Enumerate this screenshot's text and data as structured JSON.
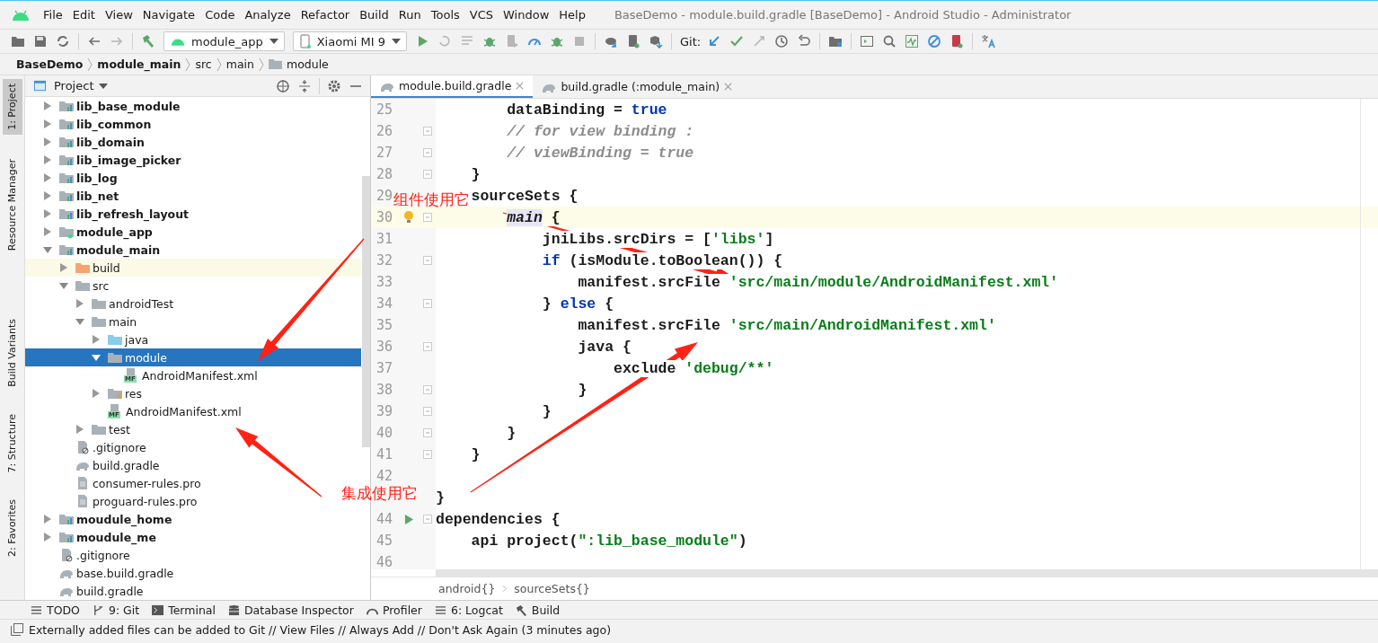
{
  "menu": [
    "File",
    "Edit",
    "View",
    "Navigate",
    "Code",
    "Analyze",
    "Refactor",
    "Build",
    "Run",
    "Tools",
    "VCS",
    "Window",
    "Help"
  ],
  "window": {
    "title": "BaseDemo - module.build.gradle [BaseDemo] - Android Studio - Administrator"
  },
  "toolbar": [
    {
      "kind": "open",
      "disabled": false
    },
    {
      "kind": "save",
      "disabled": false
    },
    {
      "kind": "sync",
      "disabled": false
    },
    {
      "kind": "separator"
    },
    {
      "kind": "back",
      "disabled": false
    },
    {
      "kind": "forward",
      "disabled": true
    },
    {
      "kind": "separator"
    },
    {
      "kind": "make",
      "disabled": false
    },
    {
      "kind": "config",
      "label": "module_app"
    },
    {
      "kind": "device",
      "label": "Xiaomi MI 9"
    },
    {
      "kind": "run",
      "disabled": false
    },
    {
      "kind": "apply_changes",
      "disabled": true
    },
    {
      "kind": "apply_code",
      "disabled": true
    },
    {
      "kind": "debug",
      "disabled": false
    },
    {
      "kind": "attach",
      "disabled": true
    },
    {
      "kind": "profile",
      "disabled": false
    },
    {
      "kind": "attach_debugger",
      "disabled": false
    },
    {
      "kind": "stop",
      "disabled": true
    },
    {
      "kind": "separator"
    },
    {
      "kind": "gradle_sync",
      "disabled": false
    },
    {
      "kind": "avd",
      "disabled": false
    },
    {
      "kind": "sdk",
      "disabled": false
    },
    {
      "kind": "separator"
    },
    {
      "kind": "label",
      "label": "Git:"
    },
    {
      "kind": "update",
      "disabled": false
    },
    {
      "kind": "commit",
      "disabled": false
    },
    {
      "kind": "push",
      "disabled": true
    },
    {
      "kind": "history",
      "disabled": false
    },
    {
      "kind": "rollback",
      "disabled": false
    },
    {
      "kind": "separator"
    },
    {
      "kind": "project_structure",
      "disabled": false
    },
    {
      "kind": "separator"
    },
    {
      "kind": "terminal",
      "disabled": false
    },
    {
      "kind": "search",
      "disabled": false
    },
    {
      "kind": "profiler",
      "disabled": false
    },
    {
      "kind": "no_entry",
      "disabled": false
    },
    {
      "kind": "device_explorer",
      "disabled": false
    },
    {
      "kind": "separator"
    },
    {
      "kind": "translate",
      "disabled": false
    }
  ],
  "breadcrumb": [
    {
      "label": "BaseDemo",
      "bold": true,
      "folder": false
    },
    {
      "label": "module_main",
      "bold": true,
      "folder": false
    },
    {
      "label": "src",
      "bold": false,
      "folder": false
    },
    {
      "label": "main",
      "bold": false,
      "folder": false
    },
    {
      "label": "module",
      "bold": false,
      "folder": true
    }
  ],
  "tool_stripe": [
    {
      "label": "1: Project",
      "selected": true
    },
    {
      "label": "Resource Manager",
      "selected": false
    },
    {
      "label": "Build Variants",
      "selected": false
    },
    {
      "label": "7: Structure",
      "selected": false
    },
    {
      "label": "2: Favorites",
      "selected": false
    }
  ],
  "project_panel": {
    "title": "Project",
    "tree": [
      {
        "label": "lib_base_module",
        "kind": "module",
        "expanded": false,
        "selected": false,
        "ignored": false
      },
      {
        "label": "lib_common",
        "kind": "module",
        "expanded": false,
        "selected": false,
        "ignored": false
      },
      {
        "label": "lib_domain",
        "kind": "module",
        "expanded": false,
        "selected": false,
        "ignored": false
      },
      {
        "label": "lib_image_picker",
        "kind": "module",
        "expanded": false,
        "selected": false,
        "ignored": false
      },
      {
        "label": "lib_log",
        "kind": "module",
        "expanded": false,
        "selected": false,
        "ignored": false
      },
      {
        "label": "lib_net",
        "kind": "module",
        "expanded": false,
        "selected": false,
        "ignored": false
      },
      {
        "label": "lib_refresh_layout",
        "kind": "module",
        "expanded": false,
        "selected": false,
        "ignored": false
      },
      {
        "label": "module_app",
        "kind": "app_module",
        "expanded": false,
        "selected": false,
        "ignored": false
      },
      {
        "label": "module_main",
        "kind": "module",
        "expanded": true,
        "selected": false,
        "ignored": false,
        "children": [
          {
            "label": "build",
            "kind": "build_folder",
            "expanded": false,
            "selected": false,
            "ignored": true
          },
          {
            "label": "src",
            "kind": "folder",
            "expanded": true,
            "selected": false,
            "ignored": false,
            "children": [
              {
                "label": "androidTest",
                "kind": "folder",
                "expanded": false,
                "selected": false,
                "ignored": false
              },
              {
                "label": "main",
                "kind": "folder",
                "expanded": true,
                "selected": false,
                "ignored": false,
                "children": [
                  {
                    "label": "java",
                    "kind": "source_folder",
                    "expanded": false,
                    "selected": false,
                    "ignored": false
                  },
                  {
                    "label": "module",
                    "kind": "folder",
                    "expanded": true,
                    "selected": true,
                    "ignored": false,
                    "children": [
                      {
                        "label": "AndroidManifest.xml",
                        "kind": "manifest",
                        "badge": "MF",
                        "selected": false,
                        "ignored": false
                      }
                    ]
                  },
                  {
                    "label": "res",
                    "kind": "res_folder",
                    "expanded": false,
                    "selected": false,
                    "ignored": false
                  },
                  {
                    "label": "AndroidManifest.xml",
                    "kind": "manifest",
                    "badge": "MF",
                    "selected": false,
                    "ignored": false
                  }
                ]
              },
              {
                "label": "test",
                "kind": "folder",
                "expanded": false,
                "selected": false,
                "ignored": false
              }
            ]
          },
          {
            "label": ".gitignore",
            "kind": "gitignore",
            "selected": false,
            "ignored": false
          },
          {
            "label": "build.gradle",
            "kind": "gradle",
            "selected": false,
            "ignored": false
          },
          {
            "label": "consumer-rules.pro",
            "kind": "text",
            "selected": false,
            "ignored": false
          },
          {
            "label": "proguard-rules.pro",
            "kind": "text",
            "selected": false,
            "ignored": false
          }
        ]
      },
      {
        "label": "moudule_home",
        "kind": "module",
        "expanded": false,
        "selected": false,
        "ignored": false
      },
      {
        "label": "moudule_me",
        "kind": "module",
        "expanded": false,
        "selected": false,
        "ignored": false
      },
      {
        "label": ".gitignore",
        "kind": "gitignore",
        "selected": false,
        "ignored": false
      },
      {
        "label": "base.build.gradle",
        "kind": "gradle",
        "selected": false,
        "ignored": false
      },
      {
        "label": "build.gradle",
        "kind": "gradle",
        "selected": false,
        "ignored": false
      }
    ]
  },
  "tabs": [
    {
      "label": "module.build.gradle",
      "selected": true
    },
    {
      "label": "build.gradle (:module_main)",
      "selected": false
    }
  ],
  "code_lines": [
    {
      "number": "25",
      "run_marker": false,
      "intention": false,
      "fold": false,
      "current": false,
      "segments": [
        {
          "kind": "plain",
          "text": "        dataBinding = "
        },
        {
          "kind": "keyword",
          "text": "true"
        }
      ]
    },
    {
      "number": "26",
      "run_marker": false,
      "intention": false,
      "fold": true,
      "current": false,
      "segments": [
        {
          "kind": "comment",
          "text": "        // for view binding :"
        }
      ]
    },
    {
      "number": "27",
      "run_marker": false,
      "intention": false,
      "fold": true,
      "current": false,
      "segments": [
        {
          "kind": "comment",
          "text": "        // viewBinding = true"
        }
      ]
    },
    {
      "number": "28",
      "run_marker": false,
      "intention": false,
      "fold": true,
      "current": false,
      "segments": [
        {
          "kind": "plain",
          "text": "    }"
        }
      ]
    },
    {
      "number": "29",
      "run_marker": false,
      "intention": false,
      "fold": false,
      "current": false,
      "segments": [
        {
          "kind": "plain",
          "text": "    sourceSets {"
        }
      ]
    },
    {
      "number": "30",
      "run_marker": false,
      "intention": true,
      "fold": true,
      "current": true,
      "segments": [
        {
          "kind": "usage",
          "text": "        main"
        },
        {
          "kind": "plain",
          "text": " {"
        }
      ]
    },
    {
      "number": "31",
      "run_marker": false,
      "intention": false,
      "fold": false,
      "current": false,
      "segments": [
        {
          "kind": "plain",
          "text": "            jniLibs.srcDirs = ["
        },
        {
          "kind": "string",
          "text": "'libs'"
        },
        {
          "kind": "plain",
          "text": "]"
        }
      ]
    },
    {
      "number": "32",
      "run_marker": false,
      "intention": false,
      "fold": true,
      "current": false,
      "segments": [
        {
          "kind": "keyword",
          "text": "            if"
        },
        {
          "kind": "plain",
          "text": " (isModule.toBoolean()) {"
        }
      ]
    },
    {
      "number": "33",
      "run_marker": false,
      "intention": false,
      "fold": false,
      "current": false,
      "segments": [
        {
          "kind": "plain",
          "text": "                manifest.srcFile "
        },
        {
          "kind": "string",
          "text": "'src/main/module/AndroidManifest.xml'"
        }
      ]
    },
    {
      "number": "34",
      "run_marker": false,
      "intention": false,
      "fold": true,
      "current": false,
      "segments": [
        {
          "kind": "plain",
          "text": "            } "
        },
        {
          "kind": "keyword",
          "text": "else"
        },
        {
          "kind": "plain",
          "text": " {"
        }
      ]
    },
    {
      "number": "35",
      "run_marker": false,
      "intention": false,
      "fold": false,
      "current": false,
      "segments": [
        {
          "kind": "plain",
          "text": "                manifest.srcFile "
        },
        {
          "kind": "string",
          "text": "'src/main/AndroidManifest.xml'"
        }
      ]
    },
    {
      "number": "36",
      "run_marker": false,
      "intention": false,
      "fold": true,
      "current": false,
      "segments": [
        {
          "kind": "plain",
          "text": "                java {"
        }
      ]
    },
    {
      "number": "37",
      "run_marker": false,
      "intention": false,
      "fold": false,
      "current": false,
      "segments": [
        {
          "kind": "plain",
          "text": "                    exclude "
        },
        {
          "kind": "string",
          "text": "'debug/**'"
        }
      ]
    },
    {
      "number": "38",
      "run_marker": false,
      "intention": false,
      "fold": true,
      "current": false,
      "segments": [
        {
          "kind": "plain",
          "text": "                }"
        }
      ]
    },
    {
      "number": "39",
      "run_marker": false,
      "intention": false,
      "fold": true,
      "current": false,
      "segments": [
        {
          "kind": "plain",
          "text": "            }"
        }
      ]
    },
    {
      "number": "40",
      "run_marker": false,
      "intention": false,
      "fold": true,
      "current": false,
      "segments": [
        {
          "kind": "plain",
          "text": "        }"
        }
      ]
    },
    {
      "number": "41",
      "run_marker": false,
      "intention": false,
      "fold": true,
      "current": false,
      "segments": [
        {
          "kind": "plain",
          "text": "    }"
        }
      ]
    },
    {
      "number": "42",
      "run_marker": false,
      "intention": false,
      "fold": false,
      "current": false
    },
    {
      "run_marker": false,
      "intention": false,
      "fold": false,
      "current": false,
      "segments": [
        {
          "kind": "plain",
          "text": "}"
        }
      ]
    },
    {
      "number": "44",
      "run_marker": true,
      "intention": false,
      "fold": true,
      "current": false,
      "segments": [
        {
          "kind": "plain",
          "text": "dependencies {"
        }
      ]
    },
    {
      "number": "45",
      "run_marker": false,
      "intention": false,
      "fold": false,
      "current": false,
      "segments": [
        {
          "kind": "plain",
          "text": "    api project("
        },
        {
          "kind": "string",
          "text": "\":lib_base_module\""
        },
        {
          "kind": "plain",
          "text": ")"
        }
      ]
    },
    {
      "number": "46",
      "run_marker": false,
      "intention": false,
      "fold": false,
      "current": false
    }
  ],
  "editor_breadcrumb": [
    "android{}",
    "sourceSets{}"
  ],
  "bottom_tools": [
    {
      "kind": "todo",
      "label": "TODO"
    },
    {
      "kind": "git",
      "label": "9: Git"
    },
    {
      "kind": "terminal",
      "label": "Terminal"
    },
    {
      "kind": "database",
      "label": "Database Inspector"
    },
    {
      "kind": "profiler",
      "label": "Profiler"
    },
    {
      "kind": "logcat",
      "label": "6: Logcat"
    },
    {
      "kind": "build",
      "label": "Build"
    }
  ],
  "status_bar": {
    "message": "Externally added files can be added to Git // View Files // Always Add // Don't Ask Again (3 minutes ago)"
  },
  "annotations": [
    {
      "text": "组件使用它"
    },
    {
      "text": "集成使用它"
    }
  ]
}
